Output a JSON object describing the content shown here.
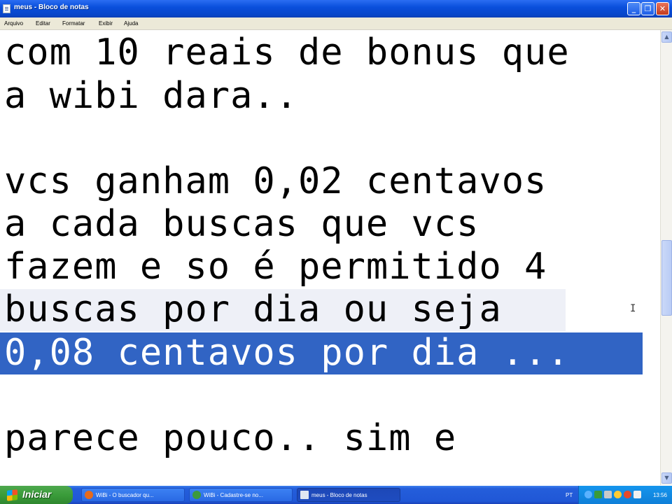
{
  "window": {
    "title": "meus - Bloco de notas"
  },
  "menu": [
    "Arquivo",
    "Editar",
    "Formatar",
    "Exibir",
    "Ajuda"
  ],
  "document": {
    "lines": [
      "com 10 reais de bonus que",
      "a wibi dara..",
      "",
      "vcs ganham 0,02 centavos",
      "a cada buscas que vcs",
      "fazem e so é permitido 4",
      "buscas por dia ou seja",
      "0,08 centavos por dia ...",
      "",
      "parece pouco.. sim e"
    ],
    "selected_line": "0,08 centavos por dia ..."
  },
  "taskbar": {
    "start_label": "Iniciar",
    "tasks": [
      {
        "label": "WiBi - O buscador qu...",
        "icon_color": "#e66a1d",
        "active": false
      },
      {
        "label": "WiBi - Cadastre-se no...",
        "icon_color": "#3c9a3c",
        "active": false
      },
      {
        "label": "meus - Bloco de notas",
        "icon_color": "#dfe6f2",
        "active": true
      }
    ],
    "language": "PT",
    "clock": "13:56"
  }
}
